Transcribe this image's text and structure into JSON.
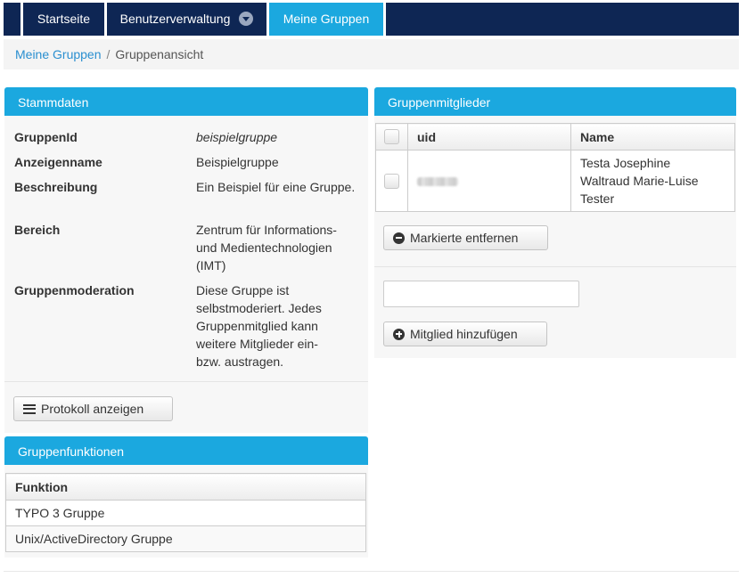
{
  "nav": {
    "items": [
      {
        "label": "Startseite"
      },
      {
        "label": "Benutzerverwaltung"
      },
      {
        "label": "Meine Gruppen"
      }
    ]
  },
  "breadcrumb": {
    "link": "Meine Gruppen",
    "separator": "/",
    "current": "Gruppenansicht"
  },
  "stammdaten": {
    "title": "Stammdaten",
    "rows": [
      {
        "term": "GruppenId",
        "value": "beispielgruppe"
      },
      {
        "term": "Anzeigenname",
        "value": "Beispielgruppe"
      },
      {
        "term": "Beschreibung",
        "value": "Ein Beispiel für eine Gruppe."
      },
      {
        "term": "Bereich",
        "value": "Zentrum für Informations- und Medientechnologien (IMT)"
      },
      {
        "term": "Gruppenmoderation",
        "value": "Diese Gruppe ist selbstmoderiert. Jedes Gruppenmitglied kann weitere Mitglieder ein- bzw. austragen."
      }
    ],
    "protocol_button": "Protokoll anzeigen"
  },
  "funktionen": {
    "title": "Gruppenfunktionen",
    "header": "Funktion",
    "rows": [
      "TYPO 3 Gruppe",
      "Unix/ActiveDirectory Gruppe"
    ]
  },
  "mitglieder": {
    "title": "Gruppenmitglieder",
    "columns": {
      "uid": "uid",
      "name": "Name"
    },
    "rows": [
      {
        "name_lines": [
          "Testa Josephine",
          "Waltraud Marie-Luise",
          "Tester"
        ]
      }
    ],
    "remove_button": "Markierte entfernen",
    "add_input": {
      "value": "",
      "placeholder": ""
    },
    "add_button": "Mitglied hinzufügen"
  },
  "icons": {
    "nav_dropdown": "chevron-down-circle-icon",
    "protocol": "list-icon",
    "remove": "minus-circle-icon",
    "add": "plus-circle-icon"
  },
  "colors": {
    "nav_bg": "#0e2654",
    "accent": "#1ba8df",
    "link": "#2a8fd0"
  }
}
